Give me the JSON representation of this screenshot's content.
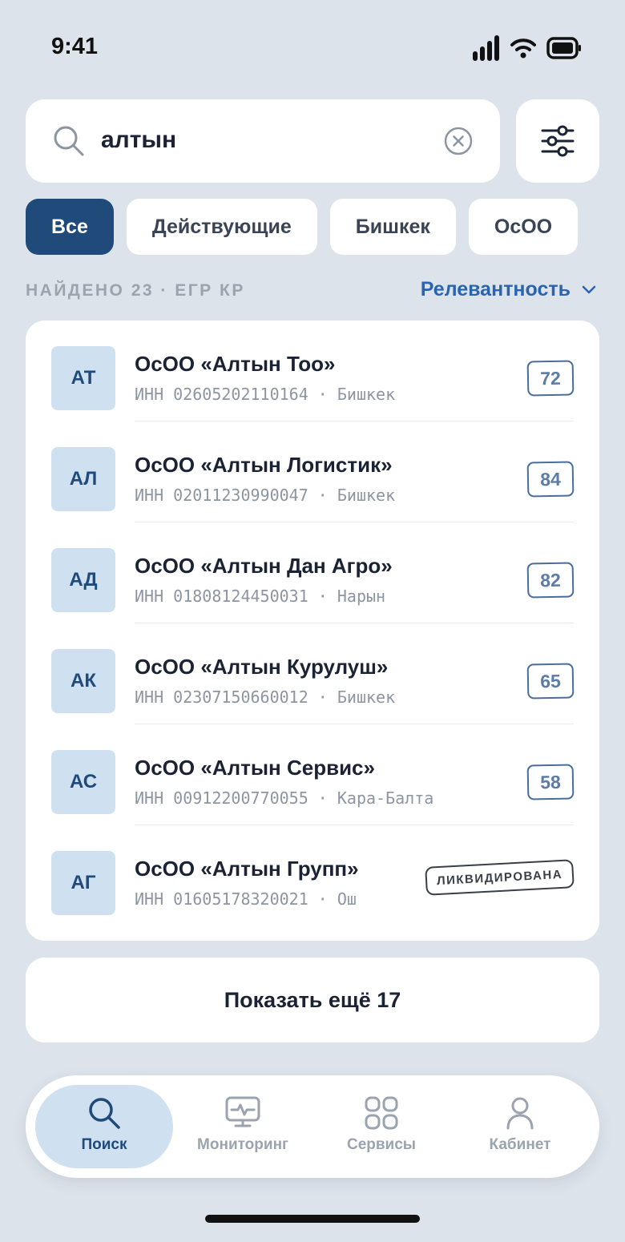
{
  "status_bar": {
    "time": "9:41"
  },
  "search": {
    "value": "алтын"
  },
  "chips": [
    {
      "label": "Все",
      "active": true
    },
    {
      "label": "Действующие",
      "active": false
    },
    {
      "label": "Бишкек",
      "active": false
    },
    {
      "label": "ОсОО",
      "active": false
    }
  ],
  "results_header": {
    "found": "НАЙДЕНО 23 · ЕГР КР",
    "sort": "Релевантность"
  },
  "results": [
    {
      "initials": "АТ",
      "name": "ОсОО «Алтын Тоо»",
      "meta": "ИНН 02605202110164 · Бишкек",
      "score": "72"
    },
    {
      "initials": "АЛ",
      "name": "ОсОО «Алтын Логистик»",
      "meta": "ИНН 02011230990047 · Бишкек",
      "score": "84"
    },
    {
      "initials": "АД",
      "name": "ОсОО «Алтын Дан Агро»",
      "meta": "ИНН 01808124450031 · Нарын",
      "score": "82"
    },
    {
      "initials": "АК",
      "name": "ОсОО «Алтын Курулуш»",
      "meta": "ИНН 02307150660012 · Бишкек",
      "score": "65"
    },
    {
      "initials": "АС",
      "name": "ОсОО «Алтын Сервис»",
      "meta": "ИНН 00912200770055 · Кара-Балта",
      "score": "58"
    },
    {
      "initials": "АГ",
      "name": "ОсОО «Алтын Групп»",
      "meta": "ИНН 01605178320021 · Ош",
      "status": "ЛИКВИДИРОВАНА"
    }
  ],
  "show_more": "Показать ещё 17",
  "tabs": [
    {
      "label": "Поиск",
      "icon": "search-icon",
      "active": true
    },
    {
      "label": "Мониторинг",
      "icon": "monitor-icon",
      "active": false
    },
    {
      "label": "Сервисы",
      "icon": "grid-icon",
      "active": false
    },
    {
      "label": "Кабинет",
      "icon": "user-icon",
      "active": false
    }
  ],
  "colors": {
    "accent": "#1f4a7a",
    "link": "#2a64b0",
    "avatar_bg": "#cfe0f1",
    "background": "#dde3eb"
  }
}
